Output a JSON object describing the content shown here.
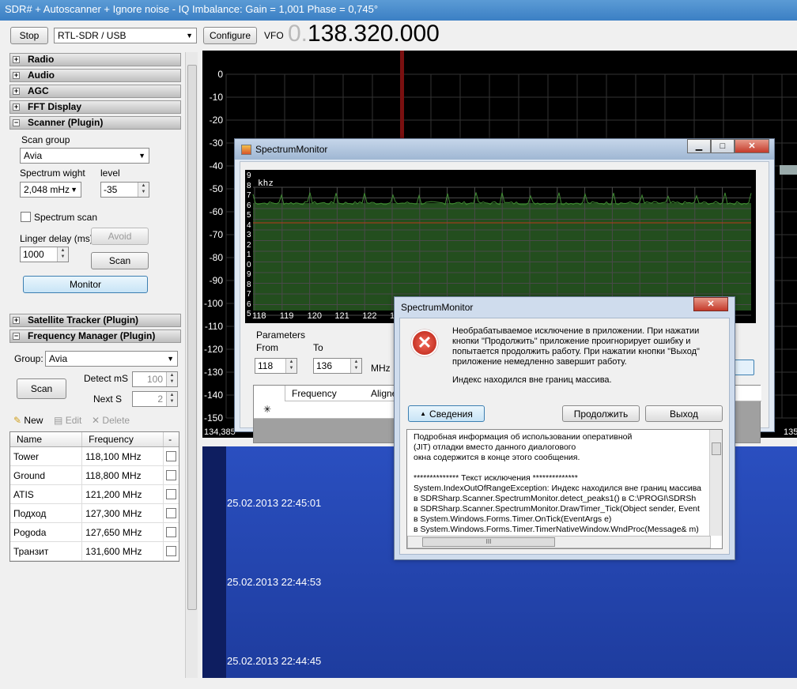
{
  "window": {
    "title": "SDR# + Autoscanner + Ignore noise - IQ Imbalance: Gain = 1,001 Phase = 0,745°"
  },
  "toolbar": {
    "stop_label": "Stop",
    "device": "RTL-SDR / USB",
    "configure_label": "Configure",
    "vfo_label": "VFO",
    "vfo_dim": "0.",
    "vfo_value": "138.320.000"
  },
  "panels": {
    "radio": "Radio",
    "audio": "Audio",
    "agc": "AGC",
    "fft": "FFT Display",
    "scanner": "Scanner (Plugin)",
    "satellite": "Satellite Tracker (Plugin)",
    "freqmgr": "Frequency Manager (Plugin)"
  },
  "scanner": {
    "scan_group_label": "Scan group",
    "scan_group_value": "Avia",
    "spectrum_width_label": "Spectrum wight",
    "spectrum_width_value": "2,048 mHz",
    "level_label": "level",
    "level_value": "-35",
    "spectrum_scan_label": "Spectrum scan",
    "linger_label": "Linger delay (ms)",
    "linger_value": "1000",
    "avoid_label": "Avoid",
    "scan_label": "Scan",
    "monitor_label": "Monitor"
  },
  "freqmgr": {
    "group_label": "Group:",
    "group_value": "Avia",
    "scan_label": "Scan",
    "detect_label": "Detect mS",
    "detect_value": "100",
    "next_label": "Next  S",
    "next_value": "2",
    "new_label": "New",
    "edit_label": "Edit",
    "delete_label": "Delete",
    "col_name": "Name",
    "col_freq": "Frequency",
    "col_extra": "-",
    "rows": [
      {
        "name": "Tower",
        "freq": "118,100 MHz"
      },
      {
        "name": "Ground",
        "freq": "118,800 MHz"
      },
      {
        "name": "ATIS",
        "freq": "121,200 MHz"
      },
      {
        "name": "Подход",
        "freq": "127,300 MHz"
      },
      {
        "name": "Pogoda",
        "freq": "127,650 MHz"
      },
      {
        "name": "Транзит",
        "freq": "131,600 MHz"
      }
    ]
  },
  "spectrum": {
    "y_labels": [
      "0",
      "-10",
      "-20",
      "-30",
      "-40",
      "-50",
      "-60",
      "-70",
      "-80",
      "-90",
      "-100",
      "-110",
      "-120",
      "-130",
      "-140",
      "-150"
    ],
    "left_freq": "134,385",
    "right_freq": "135"
  },
  "waterfall": {
    "timestamps": [
      "25.02.2013 22:45:01",
      "25.02.2013 22:44:53",
      "25.02.2013 22:44:45"
    ]
  },
  "monitor_window": {
    "title": "SpectrumMonitor",
    "unit": "khz",
    "y_digits": [
      "9",
      "8",
      "7",
      "6",
      "5",
      "4",
      "3",
      "2",
      "1",
      "0",
      "9",
      "8",
      "7",
      "6",
      "5"
    ],
    "x_labels": [
      "118",
      "119",
      "120",
      "121",
      "122",
      "123",
      "124",
      "125",
      "126",
      "127",
      "128",
      "129",
      "130",
      "131",
      "132",
      "133",
      "134",
      "135"
    ],
    "params_label": "Parameters",
    "from_label": "From",
    "from_value": "118",
    "to_label": "To",
    "to_value": "136",
    "mhz_label": "MHz",
    "col_frequency": "Frequency",
    "col_aligned": "Aligned",
    "new_row_marker": "✳"
  },
  "error_dialog": {
    "title": "SpectrumMonitor",
    "message": "Необрабатываемое исключение в приложении. При нажатии кнопки \"Продолжить\" приложение проигнорирует ошибку и попытается продолжить работу. При нажатии кнопки \"Выход\" приложение немедленно завершит работу.",
    "index_msg": "Индекс находился вне границ массива.",
    "details_label": "Сведения",
    "continue_label": "Продолжить",
    "exit_label": "Выход",
    "details_lines": [
      "Подробная информация об использовании оперативной",
      "(JIT) отладки вместо данного диалогового",
      "окна содержится в конце этого сообщения.",
      "",
      "************** Текст исключения **************",
      "System.IndexOutOfRangeException: Индекс находился вне границ массива",
      "   в SDRSharp.Scanner.SpectrumMonitor.detect_peaks1() в C:\\PROGI\\SDRSh",
      "   в SDRSharp.Scanner.SpectrumMonitor.DrawTimer_Tick(Object sender, Event",
      "   в System.Windows.Forms.Timer.OnTick(EventArgs e)",
      "   в System.Windows.Forms.Timer.TimerNativeWindow.WndProc(Message& m)"
    ],
    "hscroll_glyph": "III"
  },
  "icons": {
    "expand": "plus-icon",
    "collapse": "minus-icon",
    "error": "error-icon"
  }
}
